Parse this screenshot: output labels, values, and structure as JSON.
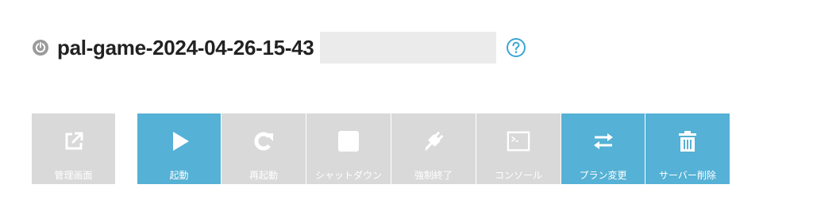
{
  "server": {
    "name": "pal-game-2024-04-26-15-43",
    "status_icon": "power-status-icon",
    "help_icon": "question-circle-icon"
  },
  "colors": {
    "active": "#55b1d5",
    "disabled": "#d9d9d9",
    "help": "#3ba6d3"
  },
  "toolbar": {
    "external": {
      "label": "管理画面",
      "icon": "external-link-icon"
    },
    "start": {
      "label": "起動",
      "icon": "play-icon"
    },
    "restart": {
      "label": "再起動",
      "icon": "restart-icon"
    },
    "shutdown": {
      "label": "シャットダウン",
      "icon": "stop-icon"
    },
    "force_stop": {
      "label": "強制終了",
      "icon": "unplug-icon"
    },
    "console": {
      "label": "コンソール",
      "icon": "console-icon"
    },
    "plan_change": {
      "label": "プラン変更",
      "icon": "swap-arrows-icon"
    },
    "delete": {
      "label": "サーバー削除",
      "icon": "trash-icon"
    }
  }
}
